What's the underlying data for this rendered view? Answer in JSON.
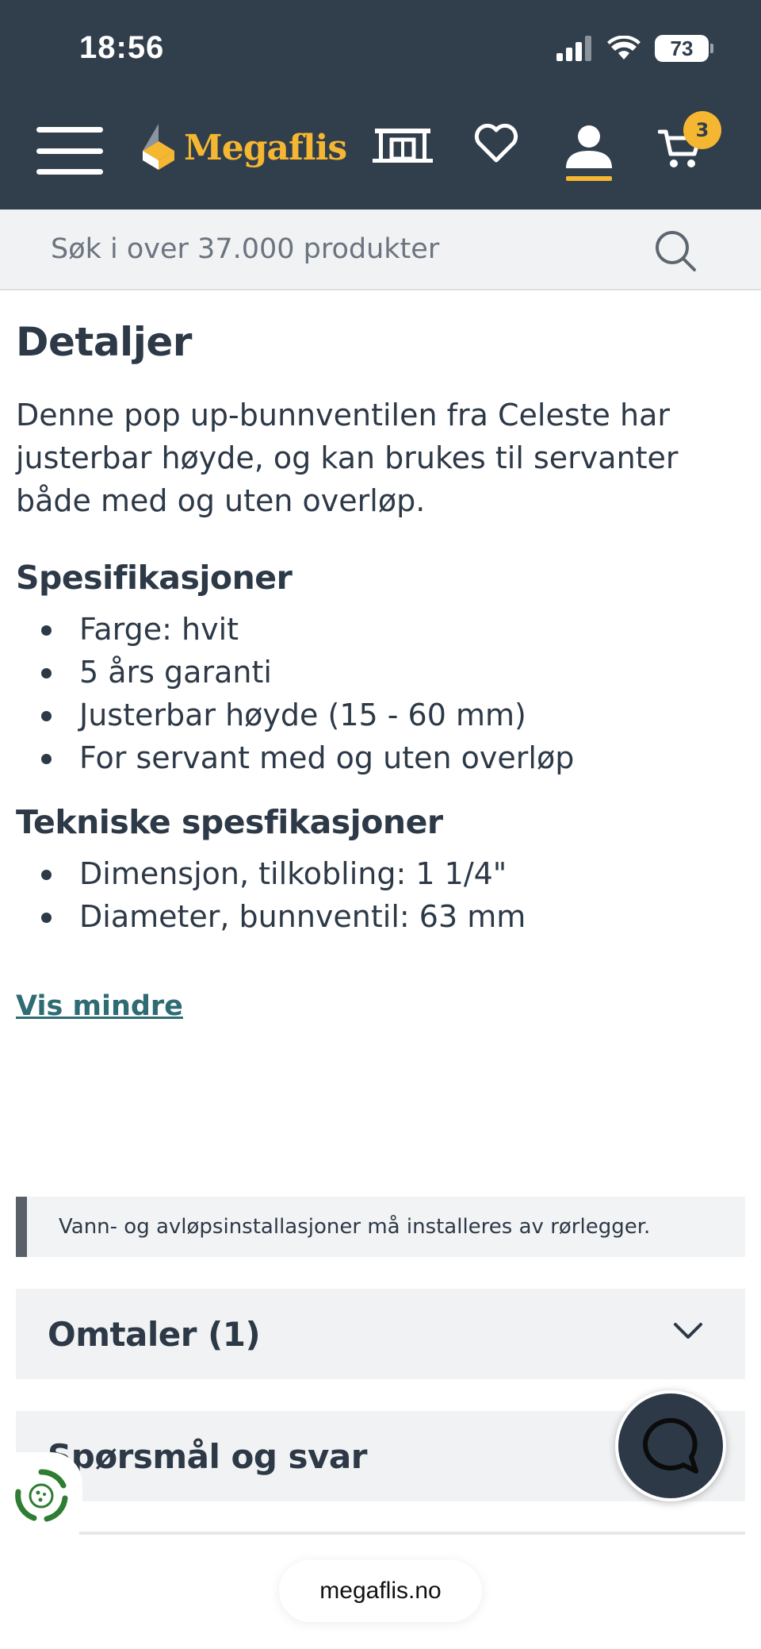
{
  "status_bar": {
    "time": "18:56",
    "battery": "73"
  },
  "header": {
    "logo_text": "Megaflis",
    "cart_count": "3"
  },
  "search": {
    "placeholder": "Søk i over 37.000 produkter"
  },
  "details": {
    "title": "Detaljer",
    "description": "Denne pop up-bunnventilen fra Celeste har justerbar høyde, og kan brukes til servanter både med og uten overløp.",
    "specs_title": "Spesifikasjoner",
    "specs": [
      "Farge: hvit",
      "5 års garanti",
      "Justerbar høyde (15 - 60 mm)",
      "For servant med og uten overløp"
    ],
    "tech_title": "Tekniske spesfikasjoner",
    "tech_specs": [
      "Dimensjon, tilkobling: 1 1/4\"",
      "Diameter, bunnventil: 63 mm"
    ],
    "show_less": "Vis mindre"
  },
  "notice": {
    "text": "Vann- og avløpsinstallasjoner må installeres av rørlegger."
  },
  "accordions": {
    "reviews": "Omtaler (1)",
    "qa": "Spørsmål og svar"
  },
  "browser": {
    "url": "megaflis.no"
  },
  "colors": {
    "header_bg": "#313e4c",
    "brand_yellow": "#f5b731",
    "link": "#2e6b73"
  }
}
